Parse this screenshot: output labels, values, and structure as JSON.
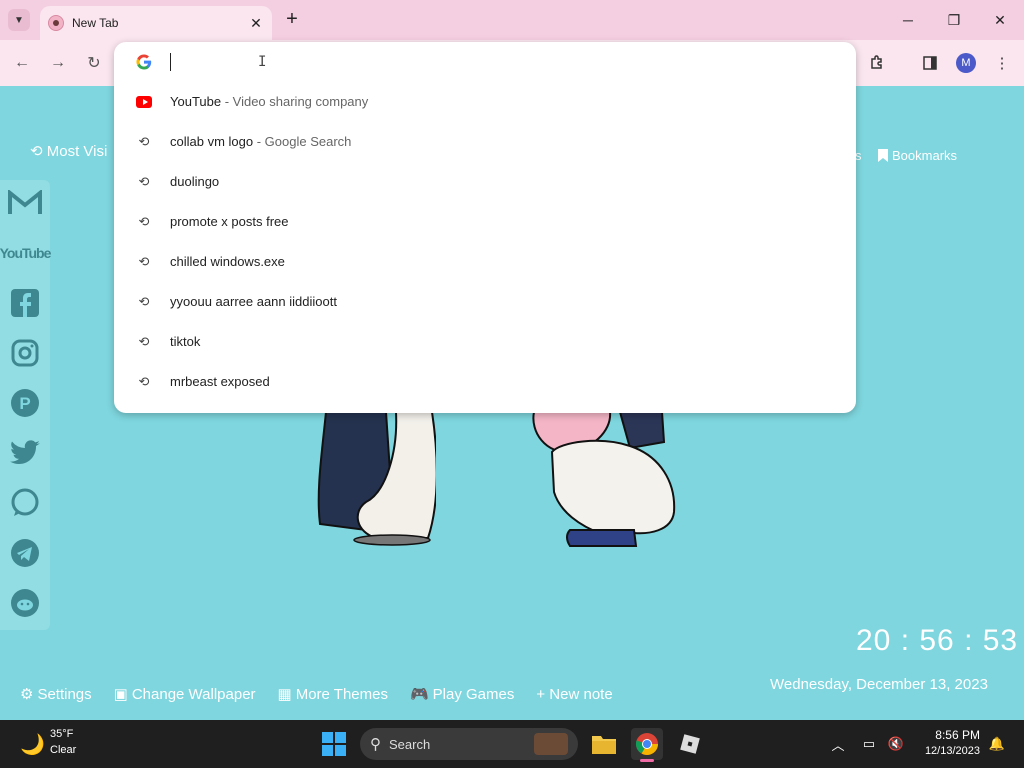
{
  "browser": {
    "tab_title": "New Tab",
    "new_tab_icon": "+",
    "close_icon": "✕",
    "profile_initial": "M"
  },
  "omnibox": {
    "input_value": "",
    "suggestions": [
      {
        "icon": "youtube-icon",
        "text": "YouTube",
        "sub": " - Video sharing company"
      },
      {
        "icon": "history-icon",
        "text": "collab vm logo",
        "sub": " - Google Search"
      },
      {
        "icon": "history-icon",
        "text": "duolingo",
        "sub": ""
      },
      {
        "icon": "history-icon",
        "text": "promote x posts free",
        "sub": ""
      },
      {
        "icon": "history-icon",
        "text": "chilled windows.exe",
        "sub": ""
      },
      {
        "icon": "history-icon",
        "text": "yyoouu aarree aann iiddiioott",
        "sub": ""
      },
      {
        "icon": "history-icon",
        "text": "tiktok",
        "sub": ""
      },
      {
        "icon": "history-icon",
        "text": "mrbeast exposed",
        "sub": ""
      }
    ]
  },
  "page": {
    "most_visited": "Most Visi",
    "bookmarks_partial": "s",
    "bookmarks": "Bookmarks",
    "clock": "20 : 56 : 53",
    "date": "Wednesday, December 13, 2023",
    "bottom_links": {
      "settings": "Settings",
      "wallpaper": "Change Wallpaper",
      "themes": "More Themes",
      "games": "Play Games",
      "note": "+ New note"
    },
    "social": [
      "gmail",
      "youtube",
      "facebook",
      "instagram",
      "pinterest",
      "twitter",
      "whatsapp",
      "telegram",
      "reddit"
    ]
  },
  "taskbar": {
    "temp": "35°F",
    "weather": "Clear",
    "search_label": "Search",
    "time": "8:56 PM",
    "date": "12/13/2023"
  },
  "colors": {
    "page_bg": "#7fd6de",
    "tabbar_bg": "#f4cfe1",
    "toolbar_bg": "#fbe6ef",
    "taskbar_bg": "#1f1f1f"
  }
}
